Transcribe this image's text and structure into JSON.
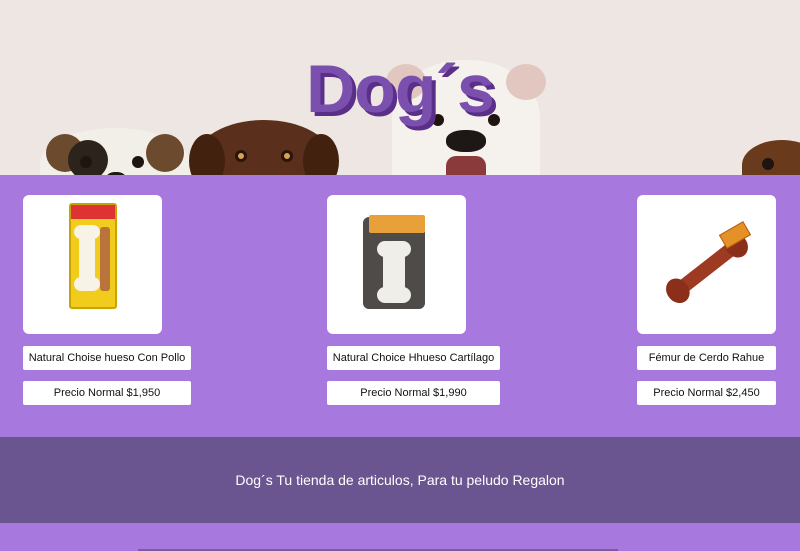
{
  "hero": {
    "title": "Dog´s"
  },
  "products": [
    {
      "name": "Natural Choise hueso Con Pollo",
      "price": "Precio Normal $1,950",
      "image_icon": "dog-bone-chicken-package-icon"
    },
    {
      "name": "Natural Choice Hhueso Cartílago",
      "price": "Precio Normal $1,990",
      "image_icon": "dog-bone-cartilage-package-icon"
    },
    {
      "name": "Fémur de Cerdo Rahue",
      "price": "Precio Normal $2,450",
      "image_icon": "pork-femur-bone-icon"
    }
  ],
  "footer": {
    "text": "Dog´s Tu tienda de articulos, Para tu peludo Regalon"
  },
  "colors": {
    "background": "#a778de",
    "footer": "#6a5590",
    "title": "#7a4fae",
    "title_shadow": "#5a2f88"
  }
}
